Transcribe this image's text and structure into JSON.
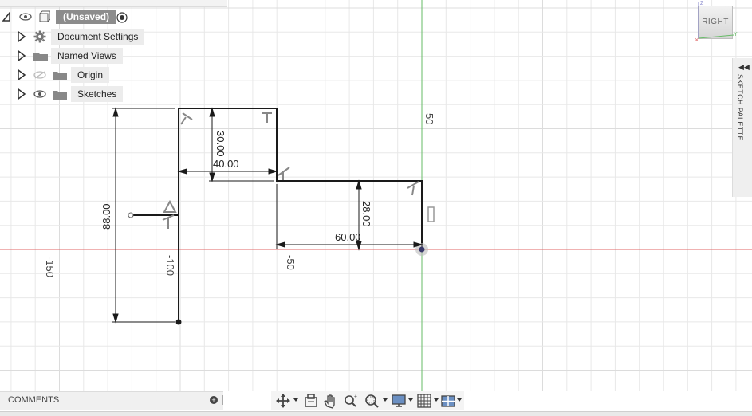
{
  "browser": {
    "root_label": "(Unsaved)",
    "items": [
      {
        "label": "Document Settings",
        "icon": "gear-icon"
      },
      {
        "label": "Named Views",
        "icon": "folder-icon"
      },
      {
        "label": "Origin",
        "icon": "folder-icon"
      },
      {
        "label": "Sketches",
        "icon": "folder-icon"
      }
    ]
  },
  "viewcube": {
    "face_label": "RIGHT"
  },
  "sketch_palette": {
    "label": "SKETCH PALETTE"
  },
  "comments": {
    "label": "COMMENTS"
  },
  "sketch": {
    "axis_labels": {
      "x_minus_150": "-150",
      "x_minus_100": "-100",
      "x_minus_50": "-50",
      "y_50": "50"
    },
    "dimensions": {
      "height_total": "88.00",
      "width_top": "40.00",
      "height_top": "30.00",
      "width_right": "60.00",
      "height_right": "28.00"
    }
  },
  "colors": {
    "x_axis": "#e06666",
    "y_axis": "#66bb66",
    "sketch_line": "#1a1a1a"
  }
}
